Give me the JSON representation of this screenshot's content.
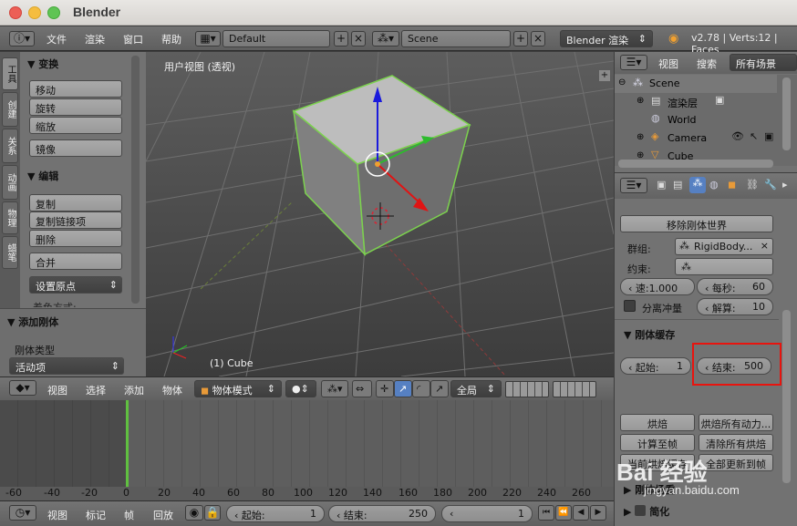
{
  "window": {
    "title": "Blender"
  },
  "info_header": {
    "menus": [
      "文件",
      "渲染",
      "窗口",
      "帮助"
    ],
    "layout": "Default",
    "scene": "Scene",
    "engine": "Blender 渲染",
    "version": "v2.78 | Verts:12 | Faces"
  },
  "tool_tabs": [
    "工具",
    "创建",
    "关系",
    "动画",
    "物理",
    "蜡笔"
  ],
  "tool_shelf": {
    "transform_title": "变换",
    "transform_buttons": [
      "移动",
      "旋转",
      "缩放"
    ],
    "mirror": "镜像",
    "edit_title": "编辑",
    "edit_buttons": [
      "复制",
      "复制链接项",
      "删除"
    ],
    "join": "合并",
    "set_origin": "设置原点",
    "shading_label": "着色方式:",
    "operator_title": "添加刚体",
    "rigidbody_type_label": "刚体类型",
    "rigidbody_type_value": "活动项"
  },
  "viewport": {
    "label": "用户视图 (透视)",
    "object_name": "(1) Cube"
  },
  "outliner": {
    "view": "视图",
    "search": "搜索",
    "filter": "所有场景",
    "items": [
      "Scene",
      "渲染层",
      "World",
      "Camera",
      "Cube"
    ]
  },
  "properties": {
    "remove_world": "移除刚体世界",
    "group_label": "群组:",
    "group_value": "RigidBody...",
    "constraint_label": "约束:",
    "speed_label": "速:",
    "speed_value": "1.000",
    "per_sec_label": "每秒:",
    "per_sec_value": "60",
    "split_impulse": "分离冲量",
    "solver_label": "解算:",
    "solver_value": "10",
    "cache_title": "刚体缓存",
    "cache_start_label": "起始:",
    "cache_start_value": "1",
    "cache_end_label": "结束:",
    "cache_end_value": "500",
    "bake": "烘焙",
    "bake_all": "烘焙所有动力...",
    "calc_to_frame": "计算至帧",
    "free_all_bakes": "清除所有烘焙",
    "current_cache_to_bake": "当前烘焙缓存",
    "update_all_to_frame": "全部更新到帧",
    "field_weights": "刚体场重",
    "simplify": "简化",
    "highlight_color": "#e8140e"
  },
  "view3d_header": {
    "menus": [
      "视图",
      "选择",
      "添加",
      "物体"
    ],
    "mode": "物体模式",
    "orientation": "全局"
  },
  "timeline": {
    "ticks": [
      "-60",
      "-40",
      "-20",
      "0",
      "20",
      "40",
      "60",
      "80",
      "100",
      "120",
      "140",
      "160",
      "180",
      "200",
      "220",
      "240",
      "260"
    ],
    "current_frame": 0
  },
  "timeline_header": {
    "menus": [
      "视图",
      "标记",
      "帧",
      "回放"
    ],
    "start_label": "起始:",
    "start_value": "1",
    "end_label": "结束:",
    "end_value": "250",
    "current": "1"
  },
  "watermark": {
    "text": "Bai 经验",
    "url": "jingyan.baidu.com"
  }
}
